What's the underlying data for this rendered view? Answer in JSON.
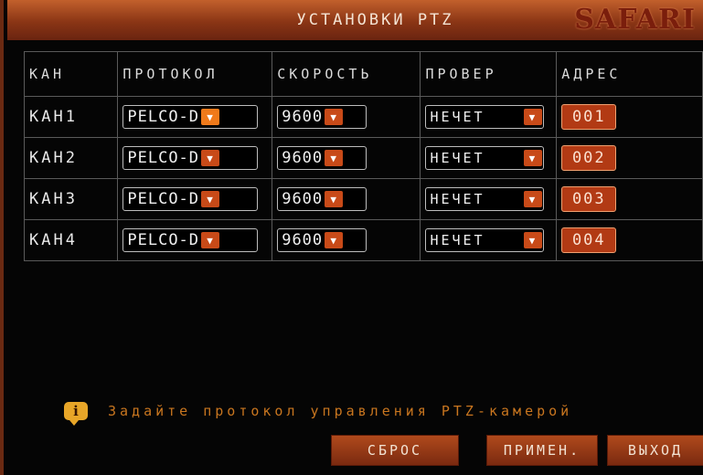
{
  "header": {
    "title": "УСТАНОВКИ PTZ",
    "logo": "SAFARI"
  },
  "table": {
    "columns": [
      "КАН",
      "ПРОТОКОЛ",
      "СКОРОСТЬ",
      "ПРОВЕР",
      "АДРЕС"
    ],
    "rows": [
      {
        "channel": "КАН1",
        "protocol": "PELCO-D",
        "speed": "9600",
        "parity": "НЕЧЕТ",
        "address": "001"
      },
      {
        "channel": "КАН2",
        "protocol": "PELCO-D",
        "speed": "9600",
        "parity": "НЕЧЕТ",
        "address": "002"
      },
      {
        "channel": "КАН3",
        "protocol": "PELCO-D",
        "speed": "9600",
        "parity": "НЕЧЕТ",
        "address": "003"
      },
      {
        "channel": "КАН4",
        "protocol": "PELCO-D",
        "speed": "9600",
        "parity": "НЕЧЕТ",
        "address": "004"
      }
    ]
  },
  "hint": {
    "icon": "info-icon",
    "text": "Задайте протокол управления PTZ-камерой"
  },
  "buttons": {
    "reset": "СБРОС",
    "apply": "ПРИМЕН.",
    "exit": "ВЫХОД"
  },
  "colors": {
    "accent": "#b23a14",
    "title_bar": "#8a3515",
    "hint_text": "#c9761f"
  }
}
